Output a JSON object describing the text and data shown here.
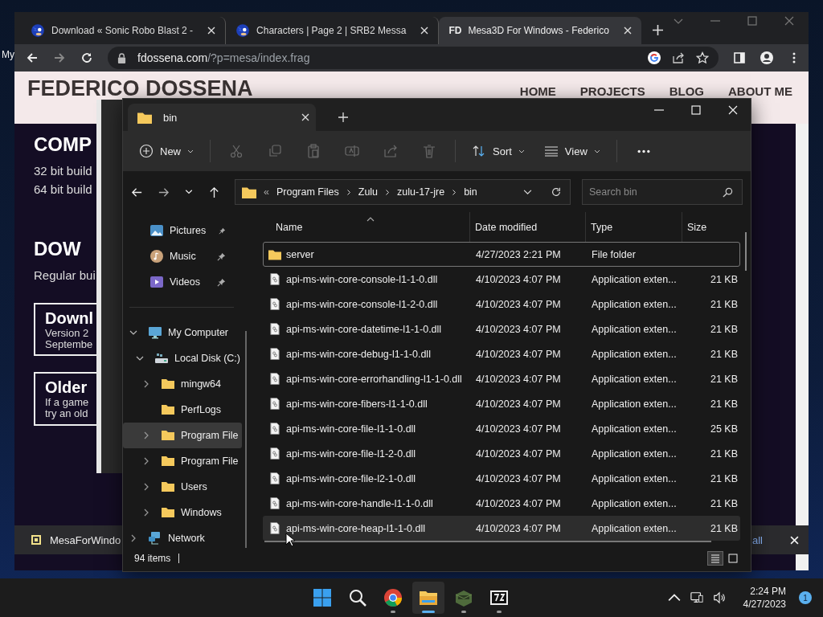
{
  "desktop": {
    "icon_labels": [
      "My"
    ]
  },
  "browser": {
    "tabs": [
      {
        "title": "Download « Sonic Robo Blast 2 -",
        "kind": "sonic",
        "selected": false
      },
      {
        "title": "Characters | Page 2 | SRB2 Messa",
        "kind": "sonic",
        "selected": false
      },
      {
        "title": "Mesa3D For Windows - Federico",
        "kind": "text",
        "favicon_text": "FD",
        "selected": true
      }
    ],
    "address": {
      "host": "fdossena.com",
      "path": "/?p=mesa/index.frag"
    },
    "site": {
      "title": "FEDERICO DOSSENA",
      "nav": [
        "HOME",
        "PROJECTS",
        "BLOG",
        "ABOUT ME"
      ],
      "blocks": [
        {
          "kind": "heading",
          "text": "COMP"
        },
        {
          "kind": "text",
          "text": "32 bit build"
        },
        {
          "kind": "text",
          "text": "64 bit build"
        },
        {
          "kind": "heading",
          "text": "DOW"
        },
        {
          "kind": "text",
          "text": "Regular bui"
        },
        {
          "kind": "card",
          "title": "Downl",
          "lines": [
            "Version 2",
            "Septembe"
          ]
        },
        {
          "kind": "card",
          "title": "Older",
          "lines": [
            "If a game",
            "try an old"
          ]
        }
      ]
    },
    "download_bar": {
      "file": "MesaForWindo",
      "link": "all"
    }
  },
  "explorer": {
    "tab": "bin",
    "toolbar": {
      "new": "New",
      "actions": [
        {
          "kind": "cut",
          "disabled": true
        },
        {
          "kind": "copy",
          "disabled": true
        },
        {
          "kind": "paste",
          "disabled": true
        },
        {
          "kind": "rename",
          "disabled": true
        },
        {
          "kind": "share",
          "disabled": true
        },
        {
          "kind": "delete",
          "disabled": true
        }
      ],
      "sort": "Sort",
      "view": "View"
    },
    "breadcrumb": {
      "overflow": "«",
      "parts": [
        "Program Files",
        "Zulu",
        "zulu-17-jre",
        "bin"
      ]
    },
    "search": {
      "placeholder": "Search bin"
    },
    "pinned": [
      {
        "label": "Pictures",
        "kind": "pictures",
        "pinned": true
      },
      {
        "label": "Music",
        "kind": "music",
        "pinned": true
      },
      {
        "label": "Videos",
        "kind": "videos",
        "pinned": true
      }
    ],
    "tree": [
      {
        "label": "My Computer",
        "kind": "computer",
        "expanded": true,
        "selected": false,
        "children": [
          {
            "label": "Local Disk (C:)",
            "kind": "drive",
            "expanded": true,
            "selected": false,
            "children": [
              {
                "label": "mingw64",
                "kind": "folder",
                "expanded": false,
                "has_children": true,
                "selected": false
              },
              {
                "label": "PerfLogs",
                "kind": "folder",
                "has_children": false,
                "selected": false
              },
              {
                "label": "Program File",
                "kind": "folder",
                "expanded": false,
                "has_children": true,
                "selected": true
              },
              {
                "label": "Program File",
                "kind": "folder",
                "expanded": false,
                "has_children": true,
                "selected": false
              },
              {
                "label": "Users",
                "kind": "folder",
                "expanded": false,
                "has_children": true,
                "selected": false
              },
              {
                "label": "Windows",
                "kind": "folder",
                "expanded": false,
                "has_children": true,
                "selected": false
              }
            ]
          }
        ]
      },
      {
        "label": "Network",
        "kind": "network",
        "expanded": false,
        "has_children": true,
        "selected": false
      }
    ],
    "columns": [
      {
        "label": "Name",
        "sorted": true
      },
      {
        "label": "Date modified",
        "sorted": false
      },
      {
        "label": "Type",
        "sorted": false
      },
      {
        "label": "Size",
        "sorted": false
      }
    ],
    "rows": [
      {
        "name": "server",
        "kind": "folder",
        "date": "4/27/2023 2:21 PM",
        "type": "File folder",
        "focused": true,
        "hovered": false
      },
      {
        "name": "api-ms-win-core-console-l1-1-0.dll",
        "kind": "dll",
        "date": "4/10/2023 4:07 PM",
        "type": "Application exten...",
        "size": "21 KB",
        "focused": false,
        "hovered": false
      },
      {
        "name": "api-ms-win-core-console-l1-2-0.dll",
        "kind": "dll",
        "date": "4/10/2023 4:07 PM",
        "type": "Application exten...",
        "size": "21 KB",
        "focused": false,
        "hovered": false
      },
      {
        "name": "api-ms-win-core-datetime-l1-1-0.dll",
        "kind": "dll",
        "date": "4/10/2023 4:07 PM",
        "type": "Application exten...",
        "size": "21 KB",
        "focused": false,
        "hovered": false
      },
      {
        "name": "api-ms-win-core-debug-l1-1-0.dll",
        "kind": "dll",
        "date": "4/10/2023 4:07 PM",
        "type": "Application exten...",
        "size": "21 KB",
        "focused": false,
        "hovered": false
      },
      {
        "name": "api-ms-win-core-errorhandling-l1-1-0.dll",
        "kind": "dll",
        "date": "4/10/2023 4:07 PM",
        "type": "Application exten...",
        "size": "21 KB",
        "focused": false,
        "hovered": false
      },
      {
        "name": "api-ms-win-core-fibers-l1-1-0.dll",
        "kind": "dll",
        "date": "4/10/2023 4:07 PM",
        "type": "Application exten...",
        "size": "21 KB",
        "focused": false,
        "hovered": false
      },
      {
        "name": "api-ms-win-core-file-l1-1-0.dll",
        "kind": "dll",
        "date": "4/10/2023 4:07 PM",
        "type": "Application exten...",
        "size": "25 KB",
        "focused": false,
        "hovered": false
      },
      {
        "name": "api-ms-win-core-file-l1-2-0.dll",
        "kind": "dll",
        "date": "4/10/2023 4:07 PM",
        "type": "Application exten...",
        "size": "21 KB",
        "focused": false,
        "hovered": false
      },
      {
        "name": "api-ms-win-core-file-l2-1-0.dll",
        "kind": "dll",
        "date": "4/10/2023 4:07 PM",
        "type": "Application exten...",
        "size": "21 KB",
        "focused": false,
        "hovered": false
      },
      {
        "name": "api-ms-win-core-handle-l1-1-0.dll",
        "kind": "dll",
        "date": "4/10/2023 4:07 PM",
        "type": "Application exten...",
        "size": "21 KB",
        "focused": false,
        "hovered": false
      },
      {
        "name": "api-ms-win-core-heap-l1-1-0.dll",
        "kind": "dll",
        "date": "4/10/2023 4:07 PM",
        "type": "Application exten...",
        "size": "21 KB",
        "focused": false,
        "hovered": true
      }
    ],
    "status": "94 items",
    "view_modes": [
      {
        "kind": "details",
        "selected": true
      },
      {
        "kind": "tiles",
        "selected": false
      }
    ]
  },
  "taskbar": {
    "apps": [
      {
        "kind": "start",
        "running": false,
        "active": false
      },
      {
        "kind": "search",
        "running": false,
        "active": false
      },
      {
        "kind": "chrome",
        "running": true,
        "active": false
      },
      {
        "kind": "explorer",
        "running": true,
        "active": true
      },
      {
        "kind": "game",
        "running": true,
        "active": false
      },
      {
        "kind": "archiver",
        "running": true,
        "active": false
      }
    ],
    "time": "2:24 PM",
    "date": "4/27/2023",
    "notifications": "1"
  }
}
